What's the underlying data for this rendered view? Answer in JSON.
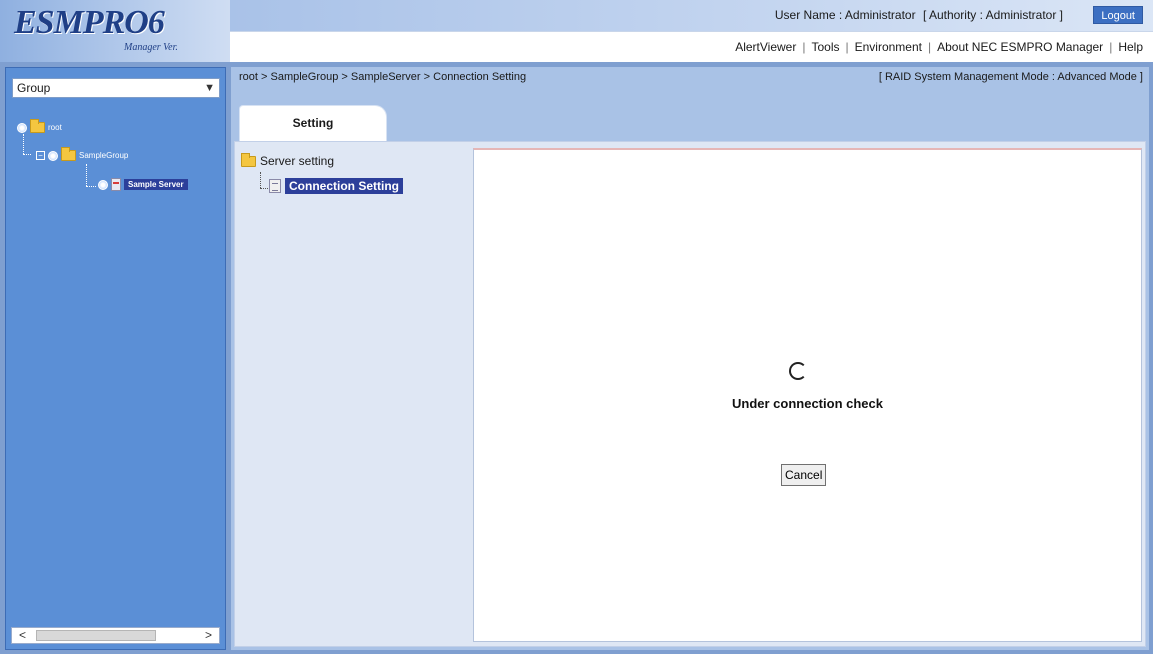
{
  "header": {
    "logo_text": "ESMPRO6",
    "logo_subtitle": "Manager Ver.",
    "user_name_label": "User Name : Administrator",
    "authority_label": "[ Authority : Administrator ]",
    "logout_label": "Logout",
    "menu": [
      {
        "label": "AlertViewer"
      },
      {
        "label": "Tools"
      },
      {
        "label": "Environment"
      },
      {
        "label": "About NEC ESMPRO Manager"
      },
      {
        "label": "Help"
      }
    ]
  },
  "sidebar": {
    "group_select_value": "Group",
    "tree": {
      "root": "root",
      "group": "SampleGroup",
      "server": "Sample Server"
    },
    "scroll_left": "<",
    "scroll_right": ">"
  },
  "main": {
    "breadcrumb": "root > SampleGroup > SampleServer > Connection Setting",
    "mode_label": "[ RAID System Management Mode : Advanced Mode ]",
    "tab_label": "Setting",
    "settings_tree": {
      "server_setting": "Server setting",
      "connection_setting": "Connection Setting"
    },
    "status_text": "Under connection check",
    "cancel_label": "Cancel"
  },
  "colors": {
    "left_panel": "#5b8fd6",
    "selection": "#2c3f9a",
    "content_bg": "#dfe7f4",
    "logout_bg": "#3c6fc2"
  }
}
